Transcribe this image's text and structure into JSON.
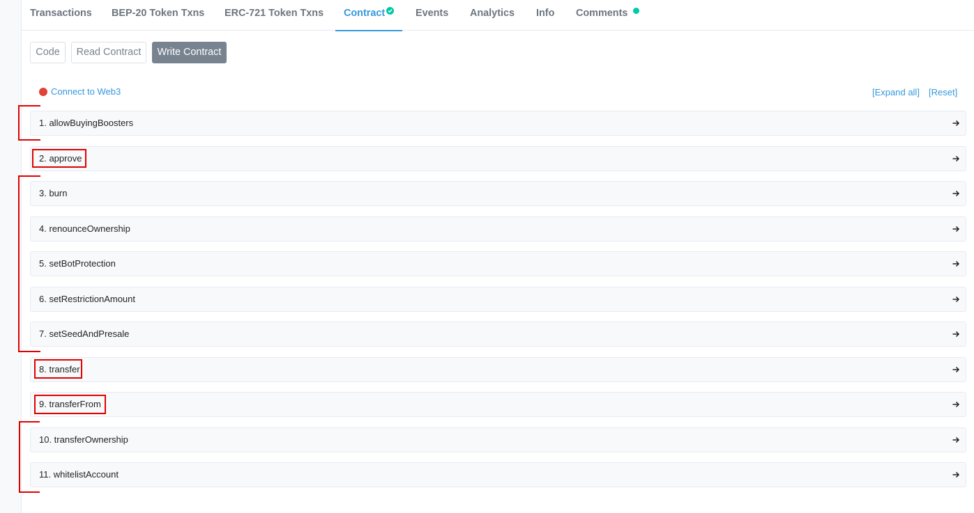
{
  "tabs": [
    {
      "label": "Transactions"
    },
    {
      "label": "BEP-20 Token Txns"
    },
    {
      "label": "ERC-721 Token Txns"
    },
    {
      "label": "Contract",
      "verified_icon": "check-circle-icon"
    },
    {
      "label": "Events"
    },
    {
      "label": "Analytics"
    },
    {
      "label": "Info"
    },
    {
      "label": "Comments",
      "badge_icon": "dot-icon"
    }
  ],
  "active_tab": "Contract",
  "subnav": {
    "code": "Code",
    "read": "Read Contract",
    "write": "Write Contract"
  },
  "connect": {
    "label": "Connect to Web3",
    "status_color": "#de4437"
  },
  "links": {
    "expand_all": "[Expand all]",
    "reset": "[Reset]"
  },
  "functions": [
    "1. allowBuyingBoosters",
    "2. approve",
    "3. burn",
    "4. renounceOwnership",
    "5. setBotProtection",
    "6. setRestrictionAmount",
    "7. setSeedAndPresale",
    "8. transfer",
    "9. transferFrom",
    "10. transferOwnership",
    "11. whitelistAccount"
  ],
  "colors": {
    "accent": "#3498db",
    "verified": "#00c9a7",
    "annotation": "#e00000",
    "active_button": "#77838f"
  }
}
